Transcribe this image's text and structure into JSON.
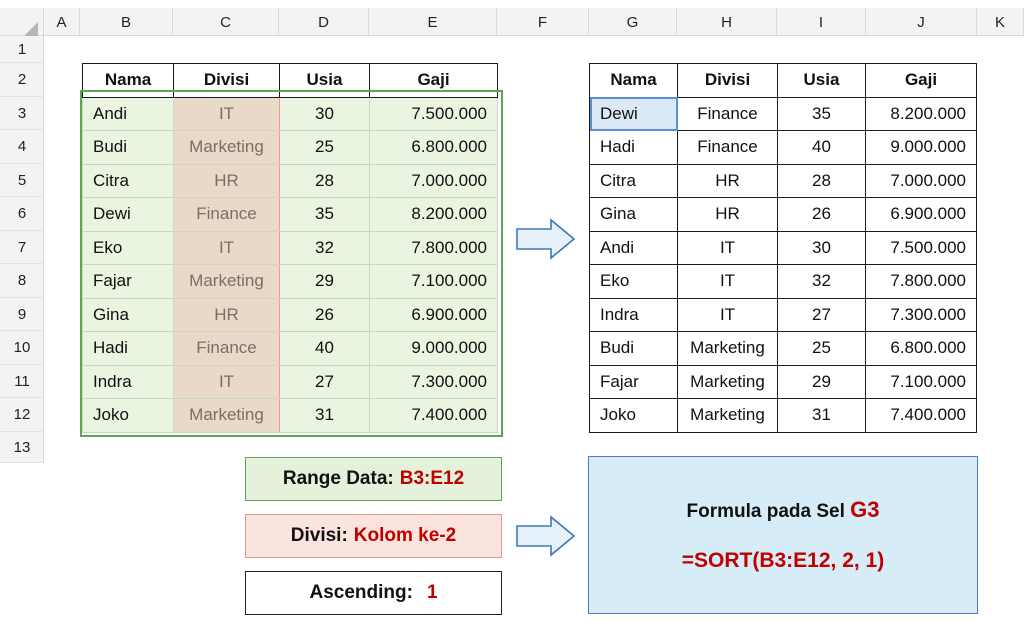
{
  "columns": [
    "A",
    "B",
    "C",
    "D",
    "E",
    "F",
    "G",
    "H",
    "I",
    "J",
    "K"
  ],
  "rows": [
    "1",
    "2",
    "3",
    "4",
    "5",
    "6",
    "7",
    "8",
    "9",
    "10",
    "11",
    "12",
    "13"
  ],
  "source_table": {
    "headers": [
      "Nama",
      "Divisi",
      "Usia",
      "Gaji"
    ],
    "rows": [
      [
        "Andi",
        "IT",
        "30",
        "7.500.000"
      ],
      [
        "Budi",
        "Marketing",
        "25",
        "6.800.000"
      ],
      [
        "Citra",
        "HR",
        "28",
        "7.000.000"
      ],
      [
        "Dewi",
        "Finance",
        "35",
        "8.200.000"
      ],
      [
        "Eko",
        "IT",
        "32",
        "7.800.000"
      ],
      [
        "Fajar",
        "Marketing",
        "29",
        "7.100.000"
      ],
      [
        "Gina",
        "HR",
        "26",
        "6.900.000"
      ],
      [
        "Hadi",
        "Finance",
        "40",
        "9.000.000"
      ],
      [
        "Indra",
        "IT",
        "27",
        "7.300.000"
      ],
      [
        "Joko",
        "Marketing",
        "31",
        "7.400.000"
      ]
    ]
  },
  "result_table": {
    "headers": [
      "Nama",
      "Divisi",
      "Usia",
      "Gaji"
    ],
    "rows": [
      [
        "Dewi",
        "Finance",
        "35",
        "8.200.000"
      ],
      [
        "Hadi",
        "Finance",
        "40",
        "9.000.000"
      ],
      [
        "Citra",
        "HR",
        "28",
        "7.000.000"
      ],
      [
        "Gina",
        "HR",
        "26",
        "6.900.000"
      ],
      [
        "Andi",
        "IT",
        "30",
        "7.500.000"
      ],
      [
        "Eko",
        "IT",
        "32",
        "7.800.000"
      ],
      [
        "Indra",
        "IT",
        "27",
        "7.300.000"
      ],
      [
        "Budi",
        "Marketing",
        "25",
        "6.800.000"
      ],
      [
        "Fajar",
        "Marketing",
        "29",
        "7.100.000"
      ],
      [
        "Joko",
        "Marketing",
        "31",
        "7.400.000"
      ]
    ]
  },
  "notes": {
    "range_label": "Range Data: ",
    "range_value": "B3:E12",
    "divisi_label": "Divisi: ",
    "divisi_value": "Kolom ke-2",
    "asc_label": "Ascending:",
    "asc_value": "1"
  },
  "formula_box": {
    "label": "Formula pada Sel",
    "cell": "G3",
    "formula": "=SORT(B3:E12, 2, 1)"
  },
  "colors": {
    "range_green": "#5ea54f",
    "divisi_fill": "#e8d9c9",
    "formula_fill": "#d6edf7",
    "accent_red": "#c00000",
    "selection_blue": "#5b8fd0"
  }
}
